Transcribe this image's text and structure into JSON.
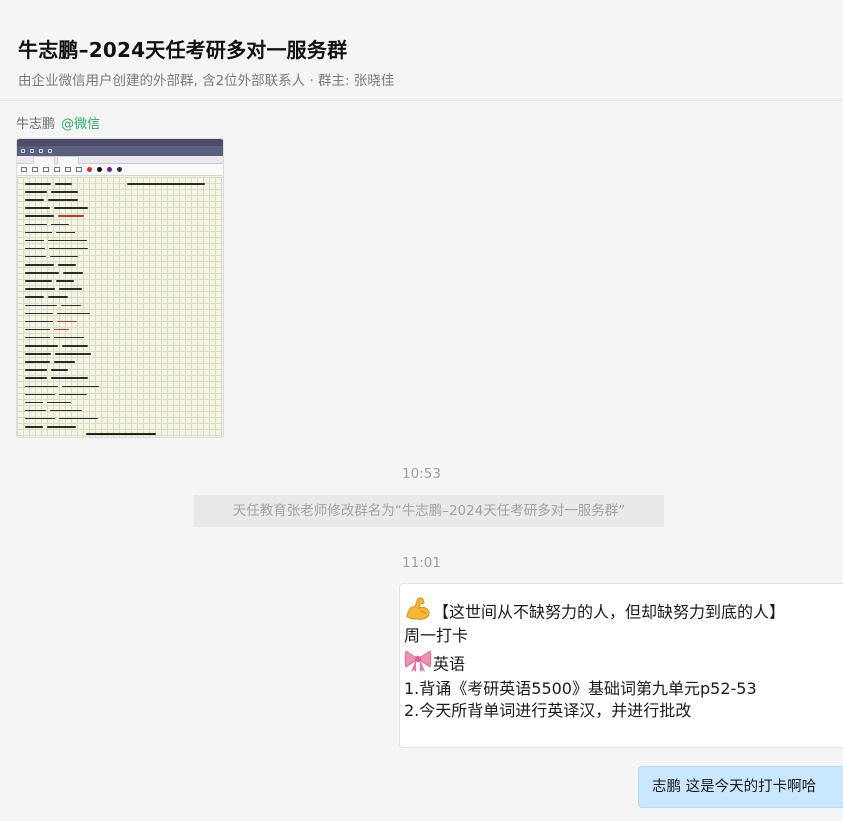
{
  "header": {
    "title": "牛志鹏–2024天任考研多对一服务群",
    "subtitle": "由企业微信用户创建的外部群, 含2位外部联系人 · 群主: 张晓佳"
  },
  "messages": {
    "first_sender": {
      "name": "牛志鹏",
      "tag": "@微信"
    },
    "image": {
      "kind": "handwritten vocabulary notes screenshot"
    },
    "timestamp_1": "10:53",
    "system_notice": "天任教育张老师修改群名为“牛志鹏–2024天任考研多对一服务群”",
    "timestamp_2": "11:01",
    "card": {
      "line1": "【这世间从不缺努力的人，但却缺努力到底的人】",
      "line1_icon": "flexed-biceps-icon",
      "line2": "周一打卡",
      "line3": "英语",
      "line3_icon": "ribbon-icon",
      "line4": "1.背诵《考研英语5500》基础词第九单元p52-53",
      "line5": "2.今天所背单词进行英译汉，并进行批改"
    },
    "self_bubble": {
      "text": "志鹏 这是今天的打卡啊哈"
    }
  },
  "colors": {
    "background": "#f5f5f5",
    "wechat_tag": "#2aae67",
    "self_bubble": "#c9e7ff",
    "system_notice_bg": "#e9e9e9"
  }
}
